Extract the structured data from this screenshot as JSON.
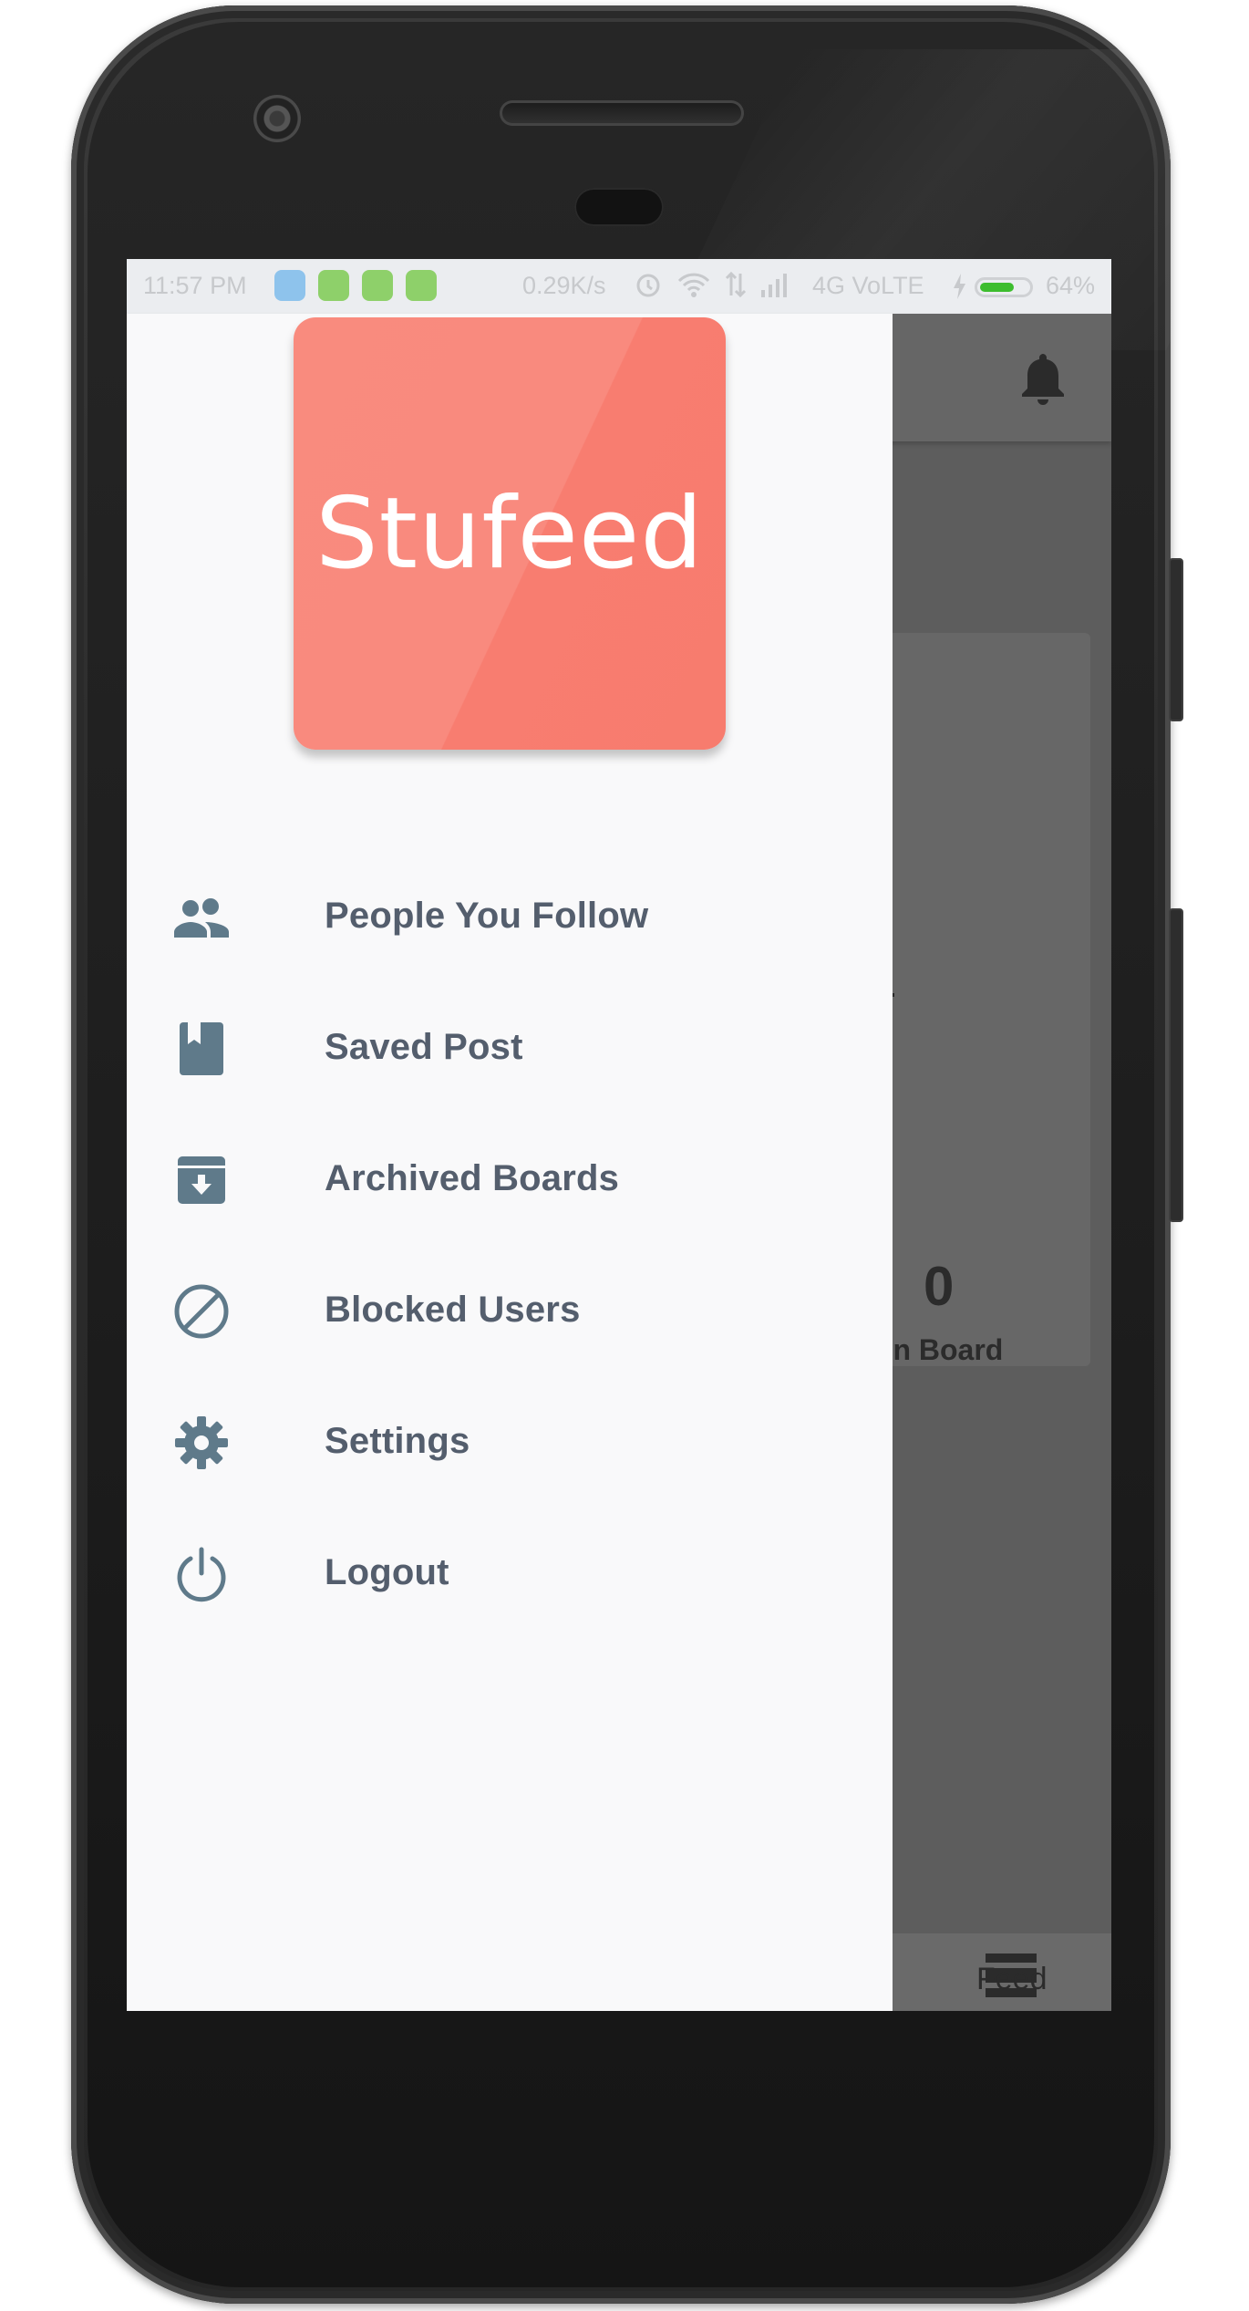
{
  "status_bar": {
    "time": "11:57 PM",
    "speed": "0.29K/s",
    "network": "4G VoLTE",
    "battery": "64%",
    "battery_level": 0.64
  },
  "drawer": {
    "logo_text": "Stufeed",
    "items": [
      {
        "label": "People You Follow",
        "icon": "people-icon"
      },
      {
        "label": "Saved Post",
        "icon": "bookmark-icon"
      },
      {
        "label": "Archived Boards",
        "icon": "archive-icon"
      },
      {
        "label": "Blocked Users",
        "icon": "block-icon"
      },
      {
        "label": "Settings",
        "icon": "gear-icon"
      },
      {
        "label": "Logout",
        "icon": "power-icon"
      }
    ]
  },
  "background_app": {
    "card_count": "0",
    "card_label": "oin Board",
    "bottom_nav_label": "Feed"
  },
  "colors": {
    "logo": "#f98b7e",
    "menu_text": "#545e6d",
    "menu_icon": "#5f7a8a",
    "drawer_bg": "#f9f9fa"
  }
}
